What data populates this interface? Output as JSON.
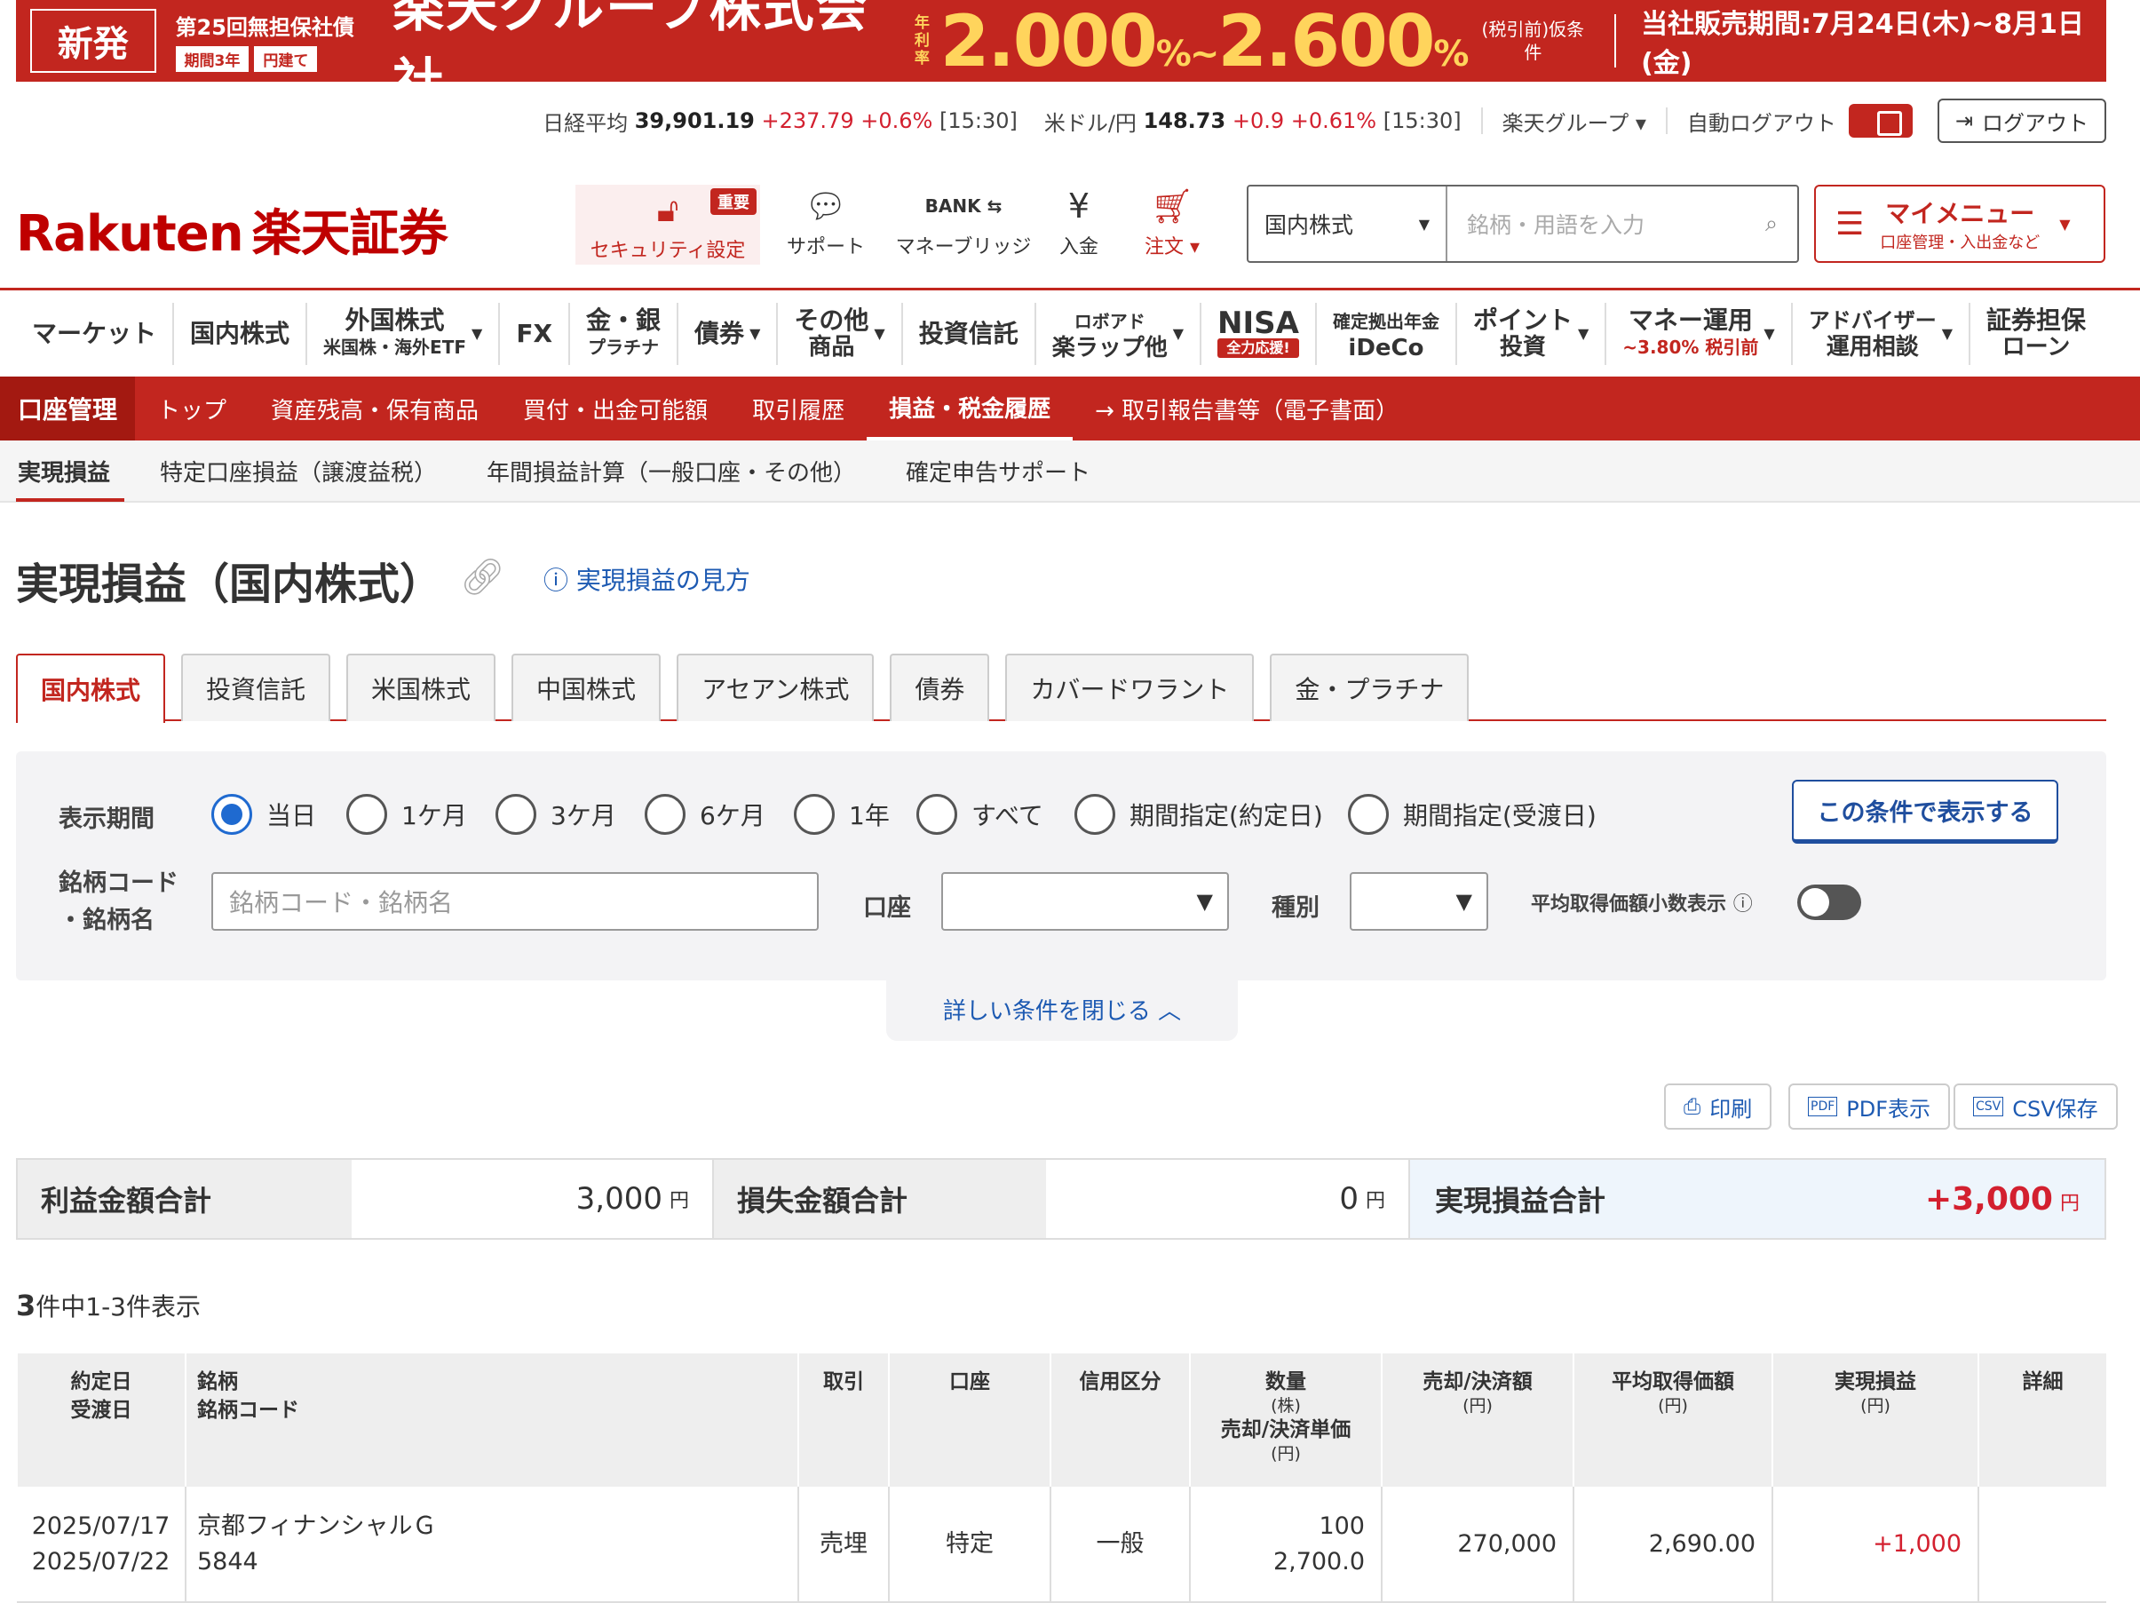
{
  "banner": {
    "new_label": "新発",
    "bond_name": "第25回無担保社債",
    "bond_term": "期間3年",
    "bond_currency": "円建て",
    "company": "楽天グループ株式会社",
    "rate_label": "年利率",
    "rate_low": "2.000",
    "rate_high": "2.600",
    "rate_unit": "%",
    "rate_sep": "~",
    "tax_note": "(税引前)仮条件",
    "period": "当社販売期間:7月24日(木)~8月1日(金)"
  },
  "market": {
    "nikkei_label": "日経平均",
    "nikkei_value": "39,901.19",
    "nikkei_change": "+237.79 +0.6%",
    "nikkei_time": "[15:30]",
    "usd_label": "米ドル/円",
    "usd_value": "148.73",
    "usd_change": "+0.9 +0.61%",
    "usd_time": "[15:30]",
    "group_label": "楽天グループ ▾",
    "auto_logout_label": "自動ログアウト",
    "logout_label": "ログアウト"
  },
  "header": {
    "logo_en": "Rakuten",
    "logo_jp": "楽天証券",
    "security_label": "セキュリティ設定",
    "security_badge": "重要",
    "support_label": "サポート",
    "bank_label": "マネーブリッジ",
    "deposit_label": "入金",
    "order_label": "注文 ▾",
    "search_scope": "国内株式",
    "search_placeholder": "銘柄・用語を入力",
    "mymenu_title": "マイメニュー",
    "mymenu_sub": "口座管理・入出金など"
  },
  "gnav": [
    {
      "label": "マーケット",
      "sub": ""
    },
    {
      "label": "国内株式",
      "sub": ""
    },
    {
      "label": "外国株式",
      "sub": "米国株・海外ETF"
    },
    {
      "label": "FX",
      "sub": ""
    },
    {
      "label": "金・銀",
      "sub": "プラチナ"
    },
    {
      "label": "債券",
      "sub": ""
    },
    {
      "label": "その他",
      "sub": "商品"
    },
    {
      "label": "投資信託",
      "sub": ""
    },
    {
      "label": "ロボアド",
      "sub": "楽ラップ他"
    },
    {
      "label": "NISA",
      "sub": "全力応援!"
    },
    {
      "label": "確定拠出年金",
      "sub": "iDeCo"
    },
    {
      "label": "ポイント",
      "sub": "投資"
    },
    {
      "label": "マネー運用",
      "sub": "~3.80% 税引前"
    },
    {
      "label": "アドバイザー",
      "sub": "運用相談"
    },
    {
      "label": "証券担保",
      "sub": "ローン"
    }
  ],
  "account_nav": {
    "title": "口座管理",
    "items": [
      "トップ",
      "資産残高・保有商品",
      "買付・出金可能額",
      "取引履歴",
      "損益・税金履歴",
      "→ 取引報告書等（電子書面）"
    ]
  },
  "subnav": [
    "実現損益",
    "特定口座損益（譲渡益税）",
    "年間損益計算（一般口座・その他）",
    "確定申告サポート"
  ],
  "page": {
    "title": "実現損益（国内株式）",
    "howto": "実現損益の見方"
  },
  "asset_tabs": [
    "国内株式",
    "投資信託",
    "米国株式",
    "中国株式",
    "アセアン株式",
    "債券",
    "カバードワラント",
    "金・プラチナ"
  ],
  "filter": {
    "period_label": "表示期間",
    "periods": [
      "当日",
      "1ケ月",
      "3ケ月",
      "6ケ月",
      "1年",
      "すべて",
      "期間指定(約定日)",
      "期間指定(受渡日)"
    ],
    "show_button": "この条件で表示する",
    "code_label_1": "銘柄コード",
    "code_label_2": "・銘柄名",
    "code_placeholder": "銘柄コード・銘柄名",
    "account_label": "口座",
    "type_label": "種別",
    "decimal_label": "平均取得価額小数表示",
    "close_label": "詳しい条件を閉じる ︿"
  },
  "actions": {
    "print": "印刷",
    "pdf": "PDF表示",
    "csv": "CSV保存"
  },
  "summary": {
    "profit_label": "利益金額合計",
    "profit_value": "3,000",
    "loss_label": "損失金額合計",
    "loss_value": "0",
    "total_label": "実現損益合計",
    "total_value": "+3,000",
    "unit": "円"
  },
  "count": {
    "num": "3",
    "text": "件中1-3件表示"
  },
  "table": {
    "headers": {
      "date1": "約定日",
      "date2": "受渡日",
      "name1": "銘柄",
      "name2": "銘柄コード",
      "trade": "取引",
      "account": "口座",
      "credit": "信用区分",
      "qty": "数量",
      "qty_unit": "(株)",
      "price": "売却/決済単価",
      "price_unit": "(円)",
      "amount": "売却/決済額",
      "amount_unit": "(円)",
      "avg": "平均取得価額",
      "avg_unit": "(円)",
      "pnl": "実現損益",
      "pnl_unit": "(円)",
      "detail": "詳細"
    },
    "rows": [
      {
        "trade_date": "2025/07/17",
        "settle_date": "2025/07/22",
        "name": "京都フィナンシャルＧ",
        "code": "5844",
        "trade": "売埋",
        "account": "特定",
        "credit": "一般",
        "qty": "100",
        "price": "2,700.0",
        "amount": "270,000",
        "avg": "2,690.00",
        "pnl": "+1,000"
      }
    ]
  }
}
